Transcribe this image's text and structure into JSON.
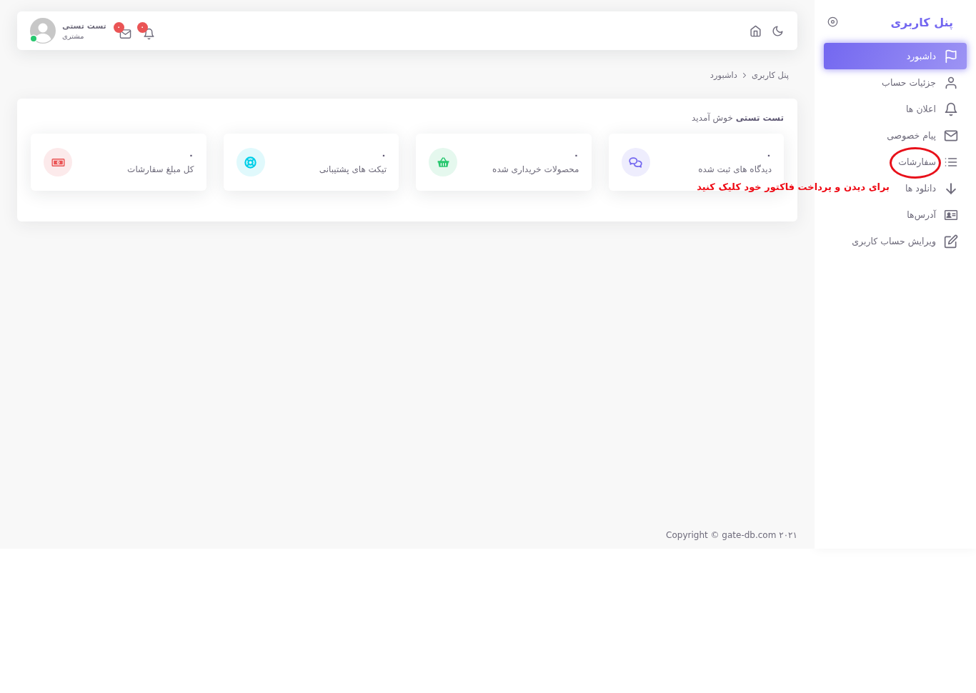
{
  "header": {
    "alerts": [
      {
        "kind": "bell",
        "badge": "۰"
      },
      {
        "kind": "mail",
        "badge": "۰"
      }
    ],
    "user": {
      "name": "تست تستی",
      "role": "مشتری",
      "online": true
    }
  },
  "breadcrumb": [
    {
      "label": "پنل کاربری"
    },
    {
      "label": "داشبورد"
    }
  ],
  "welcome": "**تست تستی** خوش آمدید",
  "stats": [
    {
      "value": "۰",
      "label": "دیدگاه های ثبت شده",
      "color": "#7367f0"
    },
    {
      "value": "۰",
      "label": "محصولات خریداری شده",
      "color": "#28c76f"
    },
    {
      "value": "۰",
      "label": "تیکت های پشتیبانی",
      "color": "#00cfe8"
    },
    {
      "value": "۰",
      "label": "کل مبلغ سفارشات",
      "color": "#ea5455"
    }
  ],
  "sidebar": {
    "title": "پنل کاربری",
    "items": [
      {
        "label": "داشبورد",
        "selected": true,
        "circled": false
      },
      {
        "label": "جزئیات حساب",
        "selected": false,
        "circled": false
      },
      {
        "label": "اعلان ها",
        "selected": false,
        "circled": false
      },
      {
        "label": "پیام خصوصی",
        "selected": false,
        "circled": false
      },
      {
        "label": "سفارشات",
        "selected": false,
        "circled": true
      },
      {
        "label": "دانلود ها",
        "selected": false,
        "circled": false
      },
      {
        "label": "آدرس‌ها",
        "selected": false,
        "circled": false
      },
      {
        "label": "ویرایش حساب کاربری",
        "selected": false,
        "circled": false
      }
    ]
  },
  "annotation": {
    "text": "برای دیدن و پرداخت فاکتور خود کلیک کنید"
  },
  "footer": {
    "copyright": "Copyright © gate-db.com ۲۰۲۱"
  }
}
